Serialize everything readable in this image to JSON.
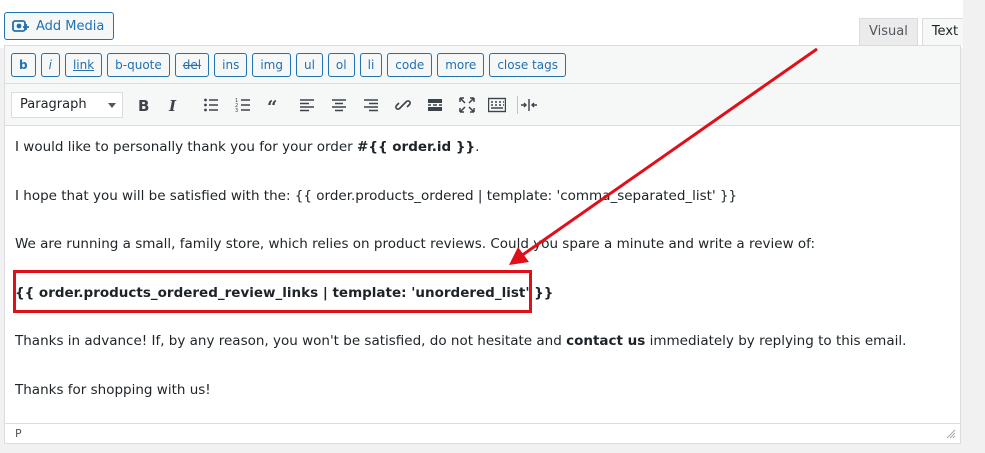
{
  "media": {
    "add_media_label": "Add Media",
    "icon": "media-camera-icon"
  },
  "tabs": [
    {
      "label": "Visual"
    },
    {
      "label": "Text"
    }
  ],
  "quicktags": [
    "b",
    "i",
    "link",
    "b-quote",
    "del",
    "ins",
    "img",
    "ul",
    "ol",
    "li",
    "code",
    "more",
    "close tags"
  ],
  "toolbar": {
    "format": "Paragraph",
    "icons": [
      "bold-icon",
      "italic-icon",
      "bulleted-list-icon",
      "numbered-list-icon",
      "blockquote-icon",
      "align-left-icon",
      "align-center-icon",
      "align-right-icon",
      "link-icon",
      "read-more-icon",
      "fullscreen-icon",
      "toolbar-toggle-icon",
      "page-break-icon"
    ]
  },
  "content": {
    "p1_before": "I would like to personally thank you for your order ",
    "p1_bold": "#{{ order.id }}",
    "p1_after": ".",
    "p2": "I hope that you will be satisfied with the: {{ order.products_ordered | template: 'comma_separated_list' }}",
    "p3": "We are running a small, family store, which relies on product reviews. Could you spare a minute and write a review of:",
    "p4": "{{ order.products_ordered_review_links | template: 'unordered_list' }}",
    "p5_before": "Thanks in advance! If, by any reason, you won't be satisfied, do not hesitate and ",
    "p5_bold": "contact us",
    "p5_after": " immediately by replying to this email.",
    "p6": "Thanks for shopping with us!"
  },
  "status": {
    "path": "P"
  },
  "colors": {
    "accent": "#2271b1",
    "annotation": "#e0101a"
  }
}
